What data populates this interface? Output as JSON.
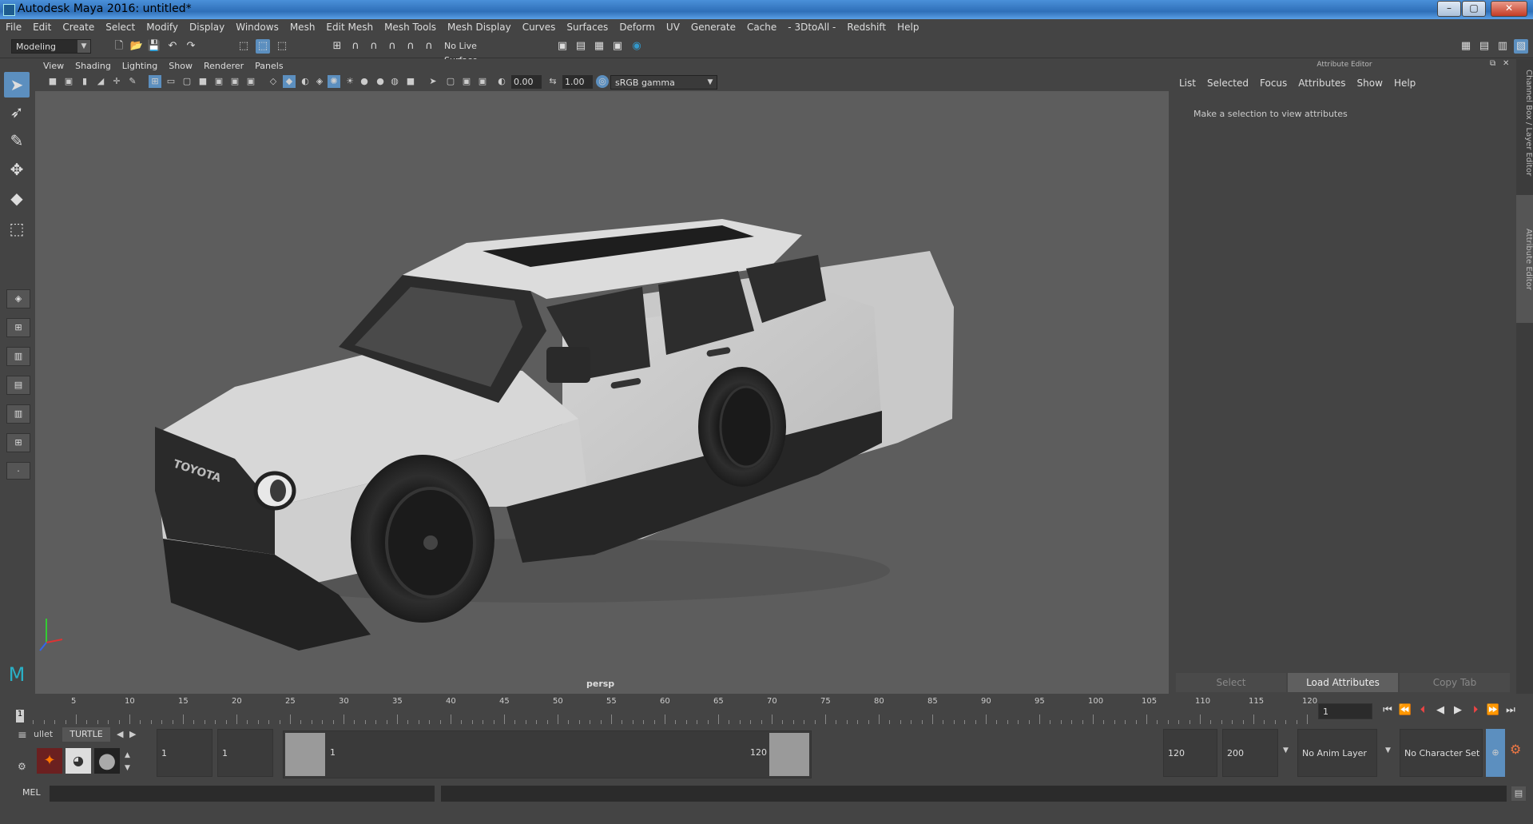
{
  "window": {
    "title": "Autodesk Maya 2016: untitled*",
    "minimize": "–",
    "maximize": "▢",
    "close": "✕"
  },
  "menubar": [
    "File",
    "Edit",
    "Create",
    "Select",
    "Modify",
    "Display",
    "Windows",
    "Mesh",
    "Edit Mesh",
    "Mesh Tools",
    "Mesh Display",
    "Curves",
    "Surfaces",
    "Deform",
    "UV",
    "Generate",
    "Cache",
    "- 3DtoAll -",
    "Redshift",
    "Help"
  ],
  "statusline": {
    "menuset": "Modeling",
    "live_surface": "No Live Surface"
  },
  "panel": {
    "menus": [
      "View",
      "Shading",
      "Lighting",
      "Show",
      "Renderer",
      "Panels"
    ],
    "exposure": "0.00",
    "gamma": "1.00",
    "colorspace": "sRGB gamma",
    "camera": "persp"
  },
  "attribute_editor": {
    "header": "Attribute Editor",
    "menus": [
      "List",
      "Selected",
      "Focus",
      "Attributes",
      "Show",
      "Help"
    ],
    "message": "Make a selection to view attributes",
    "buttons": {
      "select": "Select",
      "load": "Load Attributes",
      "copy": "Copy Tab"
    }
  },
  "side_tabs": {
    "channel_box": "Channel Box / Layer Editor",
    "attribute_editor": "Attribute Editor"
  },
  "model": {
    "brand_text": "TOYOTA"
  },
  "timeline": {
    "ticks": [
      "5",
      "10",
      "15",
      "20",
      "25",
      "30",
      "35",
      "40",
      "45",
      "50",
      "55",
      "60",
      "65",
      "70",
      "75",
      "80",
      "85",
      "90",
      "95",
      "100",
      "105",
      "110",
      "115",
      "120"
    ],
    "current_frame_marker": "1",
    "current_frame": "1"
  },
  "range": {
    "shelf_tabs": [
      "ullet",
      "TURTLE"
    ],
    "start": "1",
    "playback_start": "1",
    "range_start_label": "1",
    "range_end_label": "120",
    "playback_end": "120",
    "end": "200",
    "anim_layer": "No Anim Layer",
    "character_set": "No Character Set"
  },
  "cmdline": {
    "label": "MEL"
  },
  "colors": {
    "accent": "#5c8fbf",
    "viewport": "#5d5d5d",
    "panel": "#444444"
  }
}
